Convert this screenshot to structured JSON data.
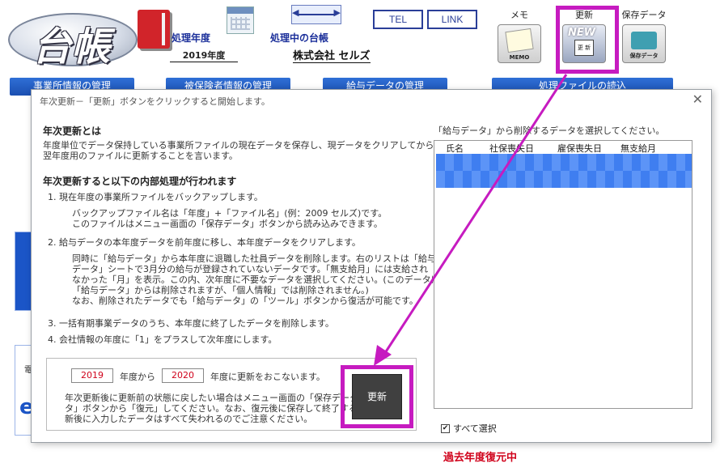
{
  "header": {
    "logo_text": "台帳",
    "processing_year_label": "処理年度",
    "processing_year_value": "2019年度",
    "company_label": "処理中の台帳",
    "company_value": "株式会社  セルズ",
    "tel_label": "TEL",
    "link_label": "LINK",
    "memo_label": "メモ",
    "memo_caption": "MEMO",
    "update_label": "更新",
    "update_new": "NEW",
    "update_inner": "更 新",
    "save_label": "保存データ",
    "save_caption": "保存データ"
  },
  "background": {
    "tabs": [
      "事業所情報の管理",
      "被保険者情報の管理",
      "給与データの管理",
      "処理ファイルの読込"
    ],
    "restore_text": "過去年度復元中"
  },
  "dialog": {
    "title": "年次更新－「更新」ボタンをクリックすると開始します。",
    "close": "✕",
    "section1_title": "年次更新とは",
    "section1_text": "年度単位でデータ保持している事業所ファイルの現在データを保存し、現データをクリアしてから\n翌年度用のファイルに更新することを言います。",
    "section2_title": "年次更新すると以下の内部処理が行われます",
    "step1": "1. 現在年度の事業所ファイルをバックアップします。",
    "step1_detail": "バックアップファイル名は「年度」+「ファイル名」(例：2009 セルズ)です。\nこのファイルはメニュー画面の「保存データ」ボタンから読み込みできます。",
    "step2": "2. 給与データの本年度データを前年度に移し、本年度データをクリアします。",
    "step2_detail": "同時に「給与データ」から本年度に退職した社員データを削除します。右のリストは「給与\nデータ」シートで3月分の給与が登録されていないデータです。「無支給月」には支給され\nなかった「月」を表示。この内、次年度に不要なデータを選択してください。(このデータは\n「給与データ」からは削除されますが、「個人情報」では削除されません。)\nなお、削除されたデータでも「給与データ」の「ツール」ボタンから復活が可能です。",
    "step3": "3. 一括有期事業データのうち、本年度に終了したデータを削除します。",
    "step4": "4. 会社情報の年度に「1」をプラスして次年度にします。",
    "year_from": "2019",
    "year_from_label": "年度から",
    "year_to": "2020",
    "year_to_label": "年度に更新をおこないます。",
    "bottom_note": "年次更新後に更新前の状態に戻したい場合はメニュー画面の「保存データ」\nタ」ボタンから「復元」してください。なお、復元後に保存して終了すると、更\n新後に入力したデータはすべて失われるのでご注意ください。",
    "update_button": "更新",
    "list_caption": "「給与データ」から削除するデータを選択してください。",
    "list_columns": [
      "氏名",
      "社保喪失日",
      "雇保喪失日",
      "無支給月"
    ],
    "select_all": "すべて選択",
    "select_all_checked": "✔"
  }
}
